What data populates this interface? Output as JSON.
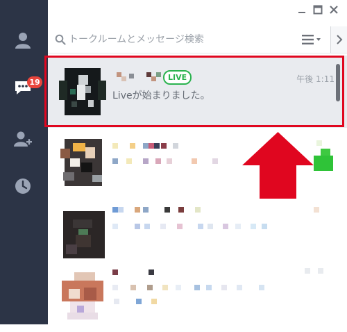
{
  "sidebar": {
    "icons": [
      "person-icon",
      "chat-bubble-icon",
      "add-friend-icon",
      "clock-icon"
    ],
    "chat_badge": "19"
  },
  "window": {
    "controls": [
      "minimize-icon",
      "maximize-icon",
      "close-icon"
    ]
  },
  "search": {
    "placeholder": "トークルームとメッセージ検索"
  },
  "chats": [
    {
      "live_badge": "LIVE",
      "time": "午後 1:11",
      "preview": "Liveが始まりました。",
      "selected": true
    }
  ],
  "colors": {
    "rail": "#2c3446",
    "badge": "#e8453c",
    "live": "#2bb34f",
    "highlight": "#e0061f"
  }
}
